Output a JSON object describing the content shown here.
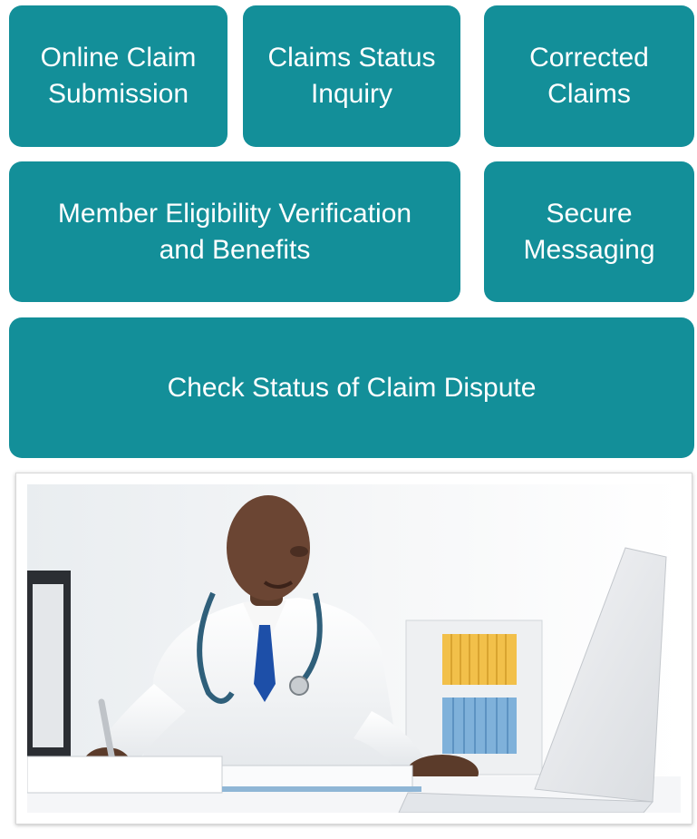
{
  "tiles": {
    "online_claim_submission": {
      "line1": "Online Claim",
      "line2": "Submission"
    },
    "claims_status_inquiry": {
      "line1": "Claims Status",
      "line2": "Inquiry"
    },
    "corrected_claims": {
      "line1": "Corrected",
      "line2": "Claims"
    },
    "member_eligibility": {
      "line1": "Member Eligibility Verification",
      "line2": "and Benefits"
    },
    "secure_messaging": {
      "line1": "Secure",
      "line2": "Messaging"
    },
    "claim_dispute_status": {
      "line1": "Check Status of Claim Dispute"
    }
  },
  "photo": {
    "subject": "doctor-at-desk-illustration"
  },
  "colors": {
    "tile_background": "#138f99",
    "tile_text": "#ffffff"
  }
}
